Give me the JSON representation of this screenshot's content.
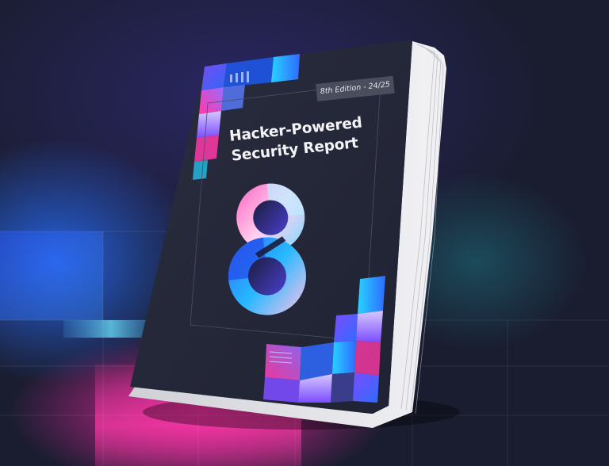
{
  "book": {
    "edition_tag": "8th Edition - 24/25",
    "title_line1": "Hacker-Powered",
    "title_line2": "Security Report"
  },
  "colors": {
    "background": "#1a1d30",
    "cover": "#232637",
    "accent_blue": "#2f6bff",
    "accent_pink": "#ff3aa8",
    "accent_cyan": "#27d3ff",
    "accent_violet": "#7b4dff"
  },
  "icons": [
    "number-eight-logo-icon"
  ]
}
